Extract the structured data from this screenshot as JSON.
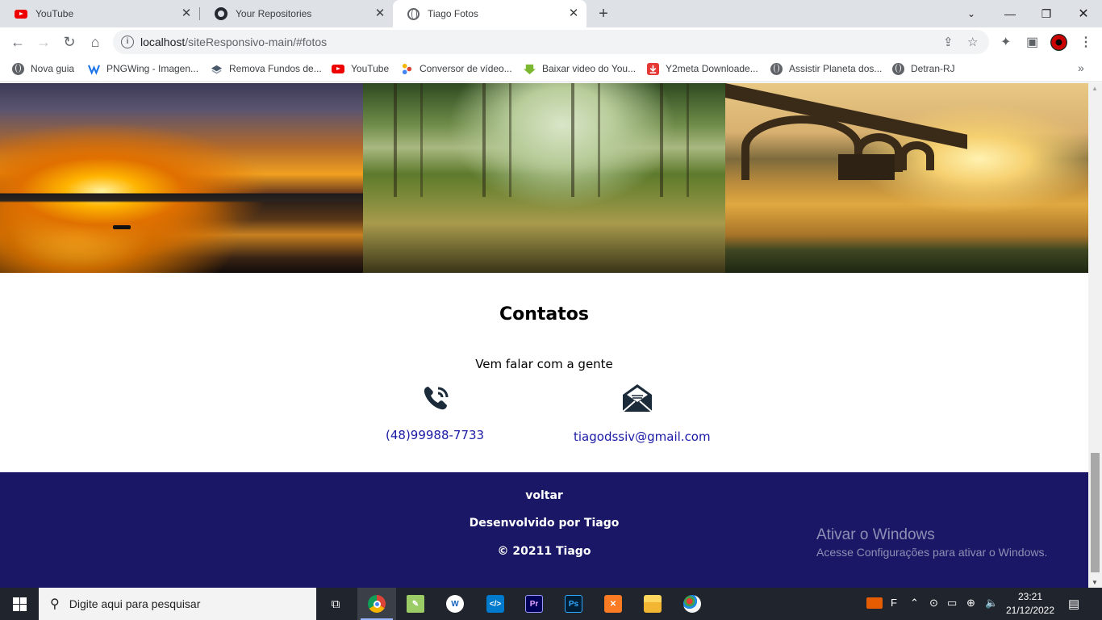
{
  "browser": {
    "tabs": [
      {
        "label": "YouTube",
        "icon": "youtube-icon",
        "active": false
      },
      {
        "label": "Your Repositories",
        "icon": "github-icon",
        "active": false
      },
      {
        "label": "Tiago Fotos",
        "icon": "globe-icon",
        "active": true
      }
    ],
    "url": {
      "host": "localhost",
      "path": "/siteResponsivo-main/#fotos"
    },
    "bookmarks": [
      {
        "label": "Nova guia",
        "icon": "globe-icon"
      },
      {
        "label": "PNGWing - Imagen...",
        "icon": "pngwing-icon"
      },
      {
        "label": "Remova Fundos de...",
        "icon": "layers-icon"
      },
      {
        "label": "YouTube",
        "icon": "youtube-icon"
      },
      {
        "label": "Conversor de vídeo...",
        "icon": "converter-icon"
      },
      {
        "label": "Baixar video do You...",
        "icon": "download-icon"
      },
      {
        "label": "Y2meta Downloade...",
        "icon": "y2meta-icon"
      },
      {
        "label": "Assistir Planeta dos...",
        "icon": "globe-icon"
      },
      {
        "label": "Detran-RJ",
        "icon": "globe-icon"
      }
    ]
  },
  "page": {
    "photos": [
      {
        "name": "sunset-over-water"
      },
      {
        "name": "forest-meadow"
      },
      {
        "name": "bridge-over-lake"
      }
    ],
    "contact": {
      "title": "Contatos",
      "subtitle": "Vem falar com a gente",
      "phone": "(48)99988-7733",
      "email": "tiagodssiv@gmail.com"
    },
    "footer": {
      "back_link": "voltar",
      "credit": "Desenvolvido por Tiago",
      "copyright": "© 20211 Tiago"
    },
    "watermark": {
      "title": "Ativar o Windows",
      "subtitle": "Acesse Configurações para ativar o Windows."
    }
  },
  "taskbar": {
    "search_placeholder": "Digite aqui para pesquisar",
    "language": "F",
    "time": "23:21",
    "date": "21/12/2022",
    "apps": [
      "chrome",
      "notepad-plus-plus",
      "wps",
      "vscode",
      "premiere",
      "photoshop",
      "xampp",
      "file-explorer",
      "paint"
    ]
  },
  "colors": {
    "footer_bg": "#1a1866",
    "link": "#1a1aa6",
    "icon_dark": "#1c2b3a"
  }
}
